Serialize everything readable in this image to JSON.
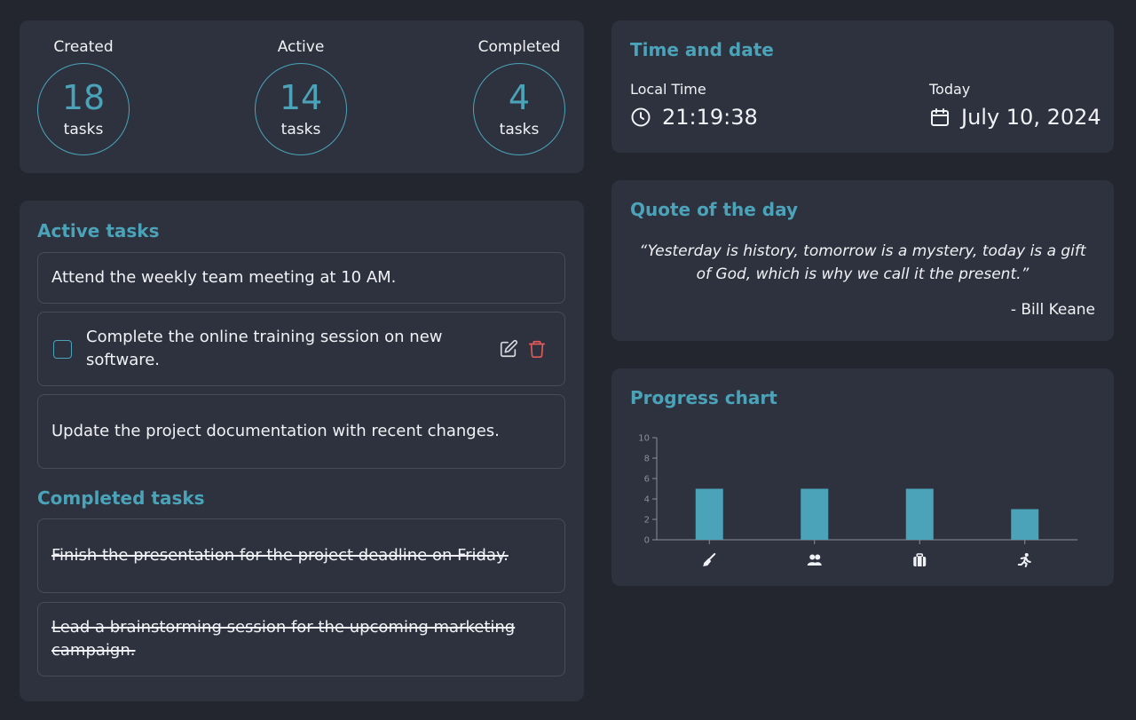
{
  "stats": [
    {
      "label": "Created",
      "value": "18",
      "unit": "tasks"
    },
    {
      "label": "Active",
      "value": "14",
      "unit": "tasks"
    },
    {
      "label": "Completed",
      "value": "4",
      "unit": "tasks"
    }
  ],
  "active_tasks": {
    "title": "Active tasks",
    "items": [
      {
        "text": "Attend the weekly team meeting at 10 AM."
      },
      {
        "text": "Complete the online training session on new software."
      },
      {
        "text": "Update the project documentation with recent changes."
      }
    ]
  },
  "completed_tasks": {
    "title": "Completed tasks",
    "items": [
      {
        "text": "Finish the presentation for the project deadline on Friday."
      },
      {
        "text": "Lead a brainstorming session for the upcoming marketing campaign."
      }
    ]
  },
  "time_date": {
    "title": "Time and date",
    "local_time_label": "Local Time",
    "local_time": "21:19:38",
    "today_label": "Today",
    "today": "July 10, 2024"
  },
  "quote": {
    "title": "Quote of the day",
    "text": "“Yesterday is history, tomorrow is a mystery, today is a gift of God, which is why we call it the present.”",
    "author": "- Bill Keane"
  },
  "progress_chart": {
    "title": "Progress chart"
  },
  "chart_data": {
    "type": "bar",
    "categories": [
      "broom-icon",
      "people-icon",
      "briefcase-icon",
      "running-icon"
    ],
    "values": [
      5,
      5,
      5,
      3
    ],
    "ylim": [
      0,
      10
    ],
    "yticks": [
      0,
      2,
      4,
      6,
      8,
      10
    ],
    "bar_color": "#4aa3b8",
    "grid": false
  },
  "colors": {
    "background": "#23262f",
    "card": "#2e323e",
    "accent": "#4aa3b8",
    "danger": "#e05a5a",
    "border": "#474c5b"
  }
}
